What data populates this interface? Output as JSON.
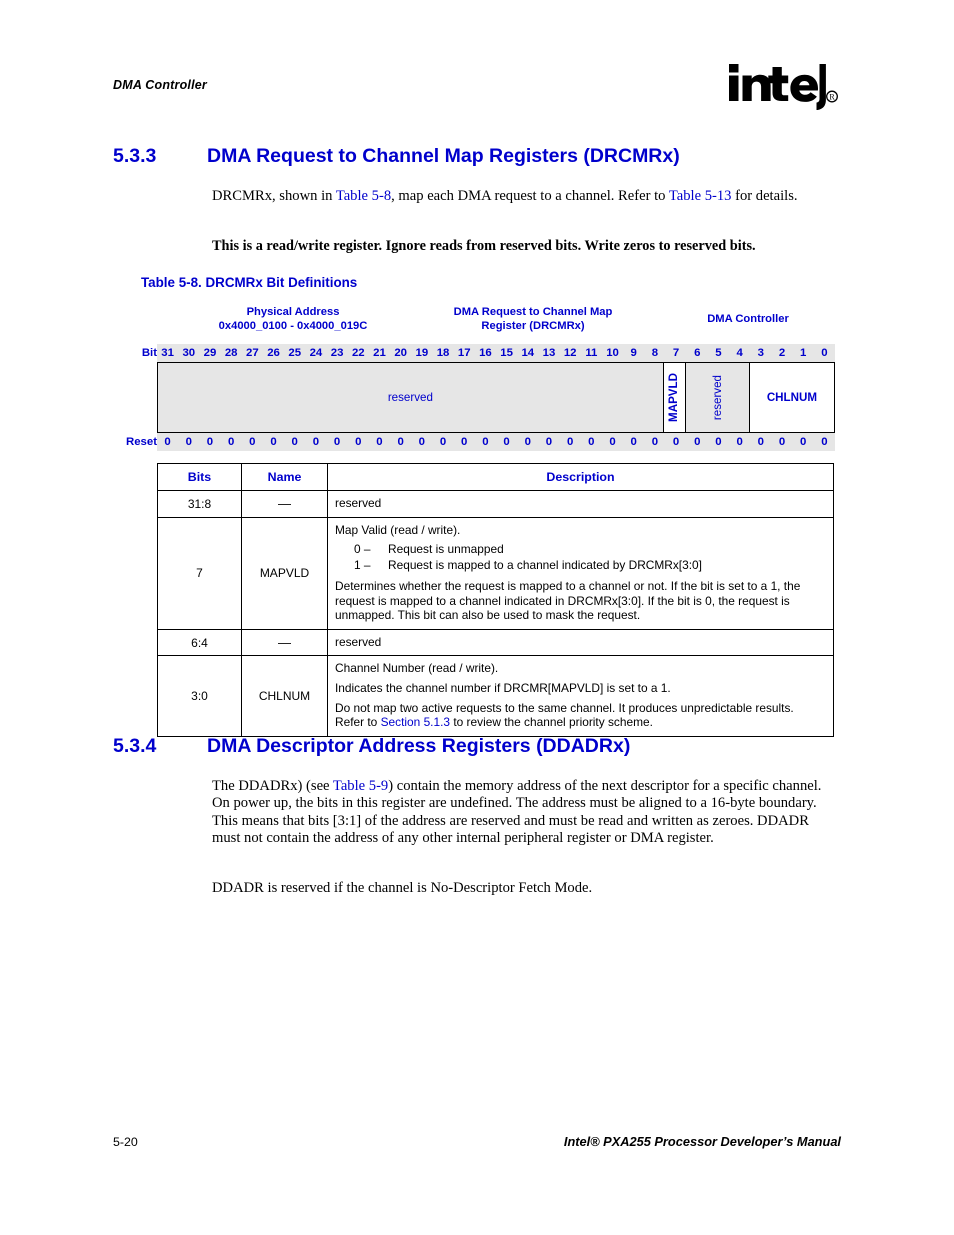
{
  "page": {
    "running_header": "DMA Controller",
    "logo_text": "intel",
    "logo_registered": "®",
    "footer_page": "5-20",
    "footer_title": "Intel® PXA255 Processor Developer’s Manual"
  },
  "section_533": {
    "number": "5.3.3",
    "title": "DMA Request to Channel Map Registers (DRCMRx)",
    "paragraph": {
      "part1": "DRCMRx, shown in ",
      "link1": "Table 5-8",
      "part2": ", map each DMA request to a channel. Refer to ",
      "link2": "Table 5-13",
      "part3": " for details."
    },
    "bold_note": "This is a read/write register. Ignore reads from reserved bits. Write zeros to reserved bits."
  },
  "table_5_8": {
    "caption": "Table 5-8. DRCMRx Bit Definitions",
    "headers": {
      "physical_address": "Physical Address\n0x4000_0100 - 0x4000_019C",
      "register_name": "DMA Request to Channel Map\nRegister (DRCMRx)",
      "unit": "DMA Controller"
    },
    "bit_row_label": "Bit",
    "reset_row_label": "Reset",
    "bit_numbers": [
      "31",
      "30",
      "29",
      "28",
      "27",
      "26",
      "25",
      "24",
      "23",
      "22",
      "21",
      "20",
      "19",
      "18",
      "17",
      "16",
      "15",
      "14",
      "13",
      "12",
      "11",
      "10",
      "9",
      "8",
      "7",
      "6",
      "5",
      "4",
      "3",
      "2",
      "1",
      "0"
    ],
    "reset_values": [
      "0",
      "0",
      "0",
      "0",
      "0",
      "0",
      "0",
      "0",
      "0",
      "0",
      "0",
      "0",
      "0",
      "0",
      "0",
      "0",
      "0",
      "0",
      "0",
      "0",
      "0",
      "0",
      "0",
      "0",
      "0",
      "0",
      "0",
      "0",
      "0",
      "0",
      "0",
      "0"
    ],
    "fields": [
      {
        "label": "reserved",
        "bits": "31:8",
        "orientation": "horizontal",
        "bold": false,
        "fill": "gray"
      },
      {
        "label": "MAPVLD",
        "bits": "7",
        "orientation": "vertical",
        "bold": true,
        "fill": "white"
      },
      {
        "label": "reserved",
        "bits": "6:4",
        "orientation": "vertical",
        "bold": false,
        "fill": "gray"
      },
      {
        "label": "CHLNUM",
        "bits": "3:0",
        "orientation": "horizontal",
        "bold": true,
        "fill": "white"
      }
    ],
    "columns": [
      "Bits",
      "Name",
      "Description"
    ],
    "rows": [
      {
        "bits": "31:8",
        "name": "—",
        "desc_paragraphs": [
          "reserved"
        ],
        "options": []
      },
      {
        "bits": "7",
        "name": "MAPVLD",
        "desc_paragraphs": [
          "Map Valid (read / write).",
          "Determines whether the request is mapped to a channel or not. If the bit is set to a 1, the request is mapped to a channel indicated in DRCMRx[3:0]. If the bit is 0, the request is unmapped. This bit can also be used to mask the request."
        ],
        "options": [
          {
            "key": "0 –",
            "text": "Request is unmapped"
          },
          {
            "key": "1 –",
            "text": "Request is mapped to a channel indicated by DRCMRx[3:0]"
          }
        ]
      },
      {
        "bits": "6:4",
        "name": "—",
        "desc_paragraphs": [
          "reserved"
        ],
        "options": []
      },
      {
        "bits": "3:0",
        "name": "CHLNUM",
        "desc_paragraphs": [
          "Channel Number (read / write).",
          "Indicates the channel number if DRCMR[MAPVLD] is set to a 1.",
          "Do not map two active requests to the same channel. It produces unpredictable results."
        ],
        "options": [],
        "last_paragraph": {
          "part1": "Refer to ",
          "link": "Section 5.1.3",
          "part2": " to review the channel priority scheme."
        }
      }
    ]
  },
  "section_534": {
    "number": "5.3.4",
    "title": "DMA Descriptor Address Registers (DDADRx)",
    "paragraph1": {
      "part1": "The DDADRx) (see ",
      "link": "Table 5-9",
      "part2": ") contain the memory address of the next descriptor for a specific channel. On power up, the bits in this register are undefined. The address must be aligned to a 16-byte boundary. This means that bits [3:1] of the address are reserved and must be read and written as zeroes. DDADR must not contain the address of any other internal peripheral register or DMA register."
    },
    "paragraph2": "DDADR is reserved if the channel is No-Descriptor Fetch Mode."
  },
  "colors": {
    "heading_blue": "#0000CC",
    "link_blue": "#0000CC",
    "band_gray": "#e6e6e6",
    "text_black": "#000000"
  }
}
